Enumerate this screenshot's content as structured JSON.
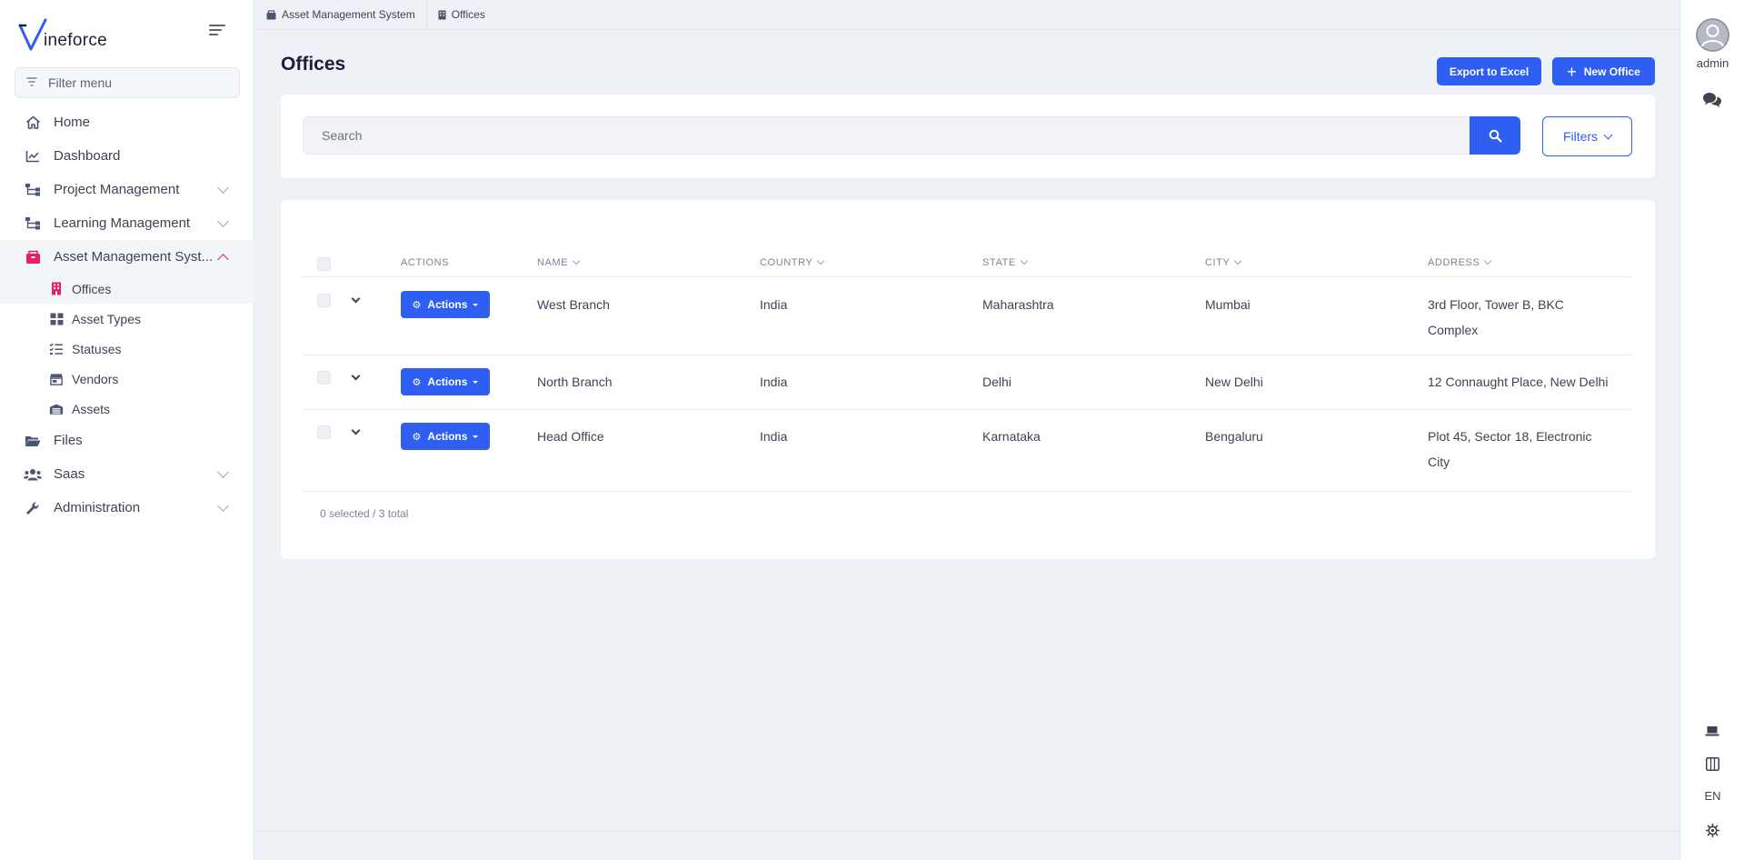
{
  "brand": {
    "name": "ineforce"
  },
  "sidebar": {
    "filter_placeholder": "Filter menu",
    "items": [
      {
        "label": "Home",
        "icon": "home-icon"
      },
      {
        "label": "Dashboard",
        "icon": "chart-line-icon"
      },
      {
        "label": "Project Management",
        "icon": "sitemap-icon"
      },
      {
        "label": "Learning Management",
        "icon": "sitemap-icon"
      },
      {
        "label": "Asset Management Syst...",
        "icon": "box-icon"
      },
      {
        "label": "Files",
        "icon": "folder-icon"
      },
      {
        "label": "Saas",
        "icon": "users-icon"
      },
      {
        "label": "Administration",
        "icon": "wrench-icon"
      }
    ],
    "sub_items": [
      {
        "label": "Offices",
        "icon": "building-icon"
      },
      {
        "label": "Asset Types",
        "icon": "grid-icon"
      },
      {
        "label": "Statuses",
        "icon": "list-check-icon"
      },
      {
        "label": "Vendors",
        "icon": "store-icon"
      },
      {
        "label": "Assets",
        "icon": "warehouse-icon"
      }
    ]
  },
  "breadcrumb": [
    "Asset Management System",
    "Offices"
  ],
  "page": {
    "title": "Offices",
    "export_label": "Export to Excel",
    "new_label": "New Office",
    "search_placeholder": "Search",
    "filters_label": "Filters"
  },
  "table": {
    "columns": [
      "Actions",
      "Name",
      "Country",
      "State",
      "City",
      "Address"
    ],
    "action_label": "Actions",
    "rows": [
      {
        "name": "West Branch",
        "country": "India",
        "state": "Maharashtra",
        "city": "Mumbai",
        "address": "3rd Floor, Tower B, BKC Complex"
      },
      {
        "name": "North Branch",
        "country": "India",
        "state": "Delhi",
        "city": "New Delhi",
        "address": "12 Connaught Place, New Delhi"
      },
      {
        "name": "Head Office",
        "country": "India",
        "state": "Karnataka",
        "city": "Bengaluru",
        "address": "Plot 45, Sector 18, Electronic City"
      }
    ],
    "footer": "0 selected / 3 total"
  },
  "rail": {
    "user": "admin",
    "language": "EN"
  },
  "colors": {
    "primary": "#2f5ef3",
    "active_accent": "#e91e63"
  }
}
